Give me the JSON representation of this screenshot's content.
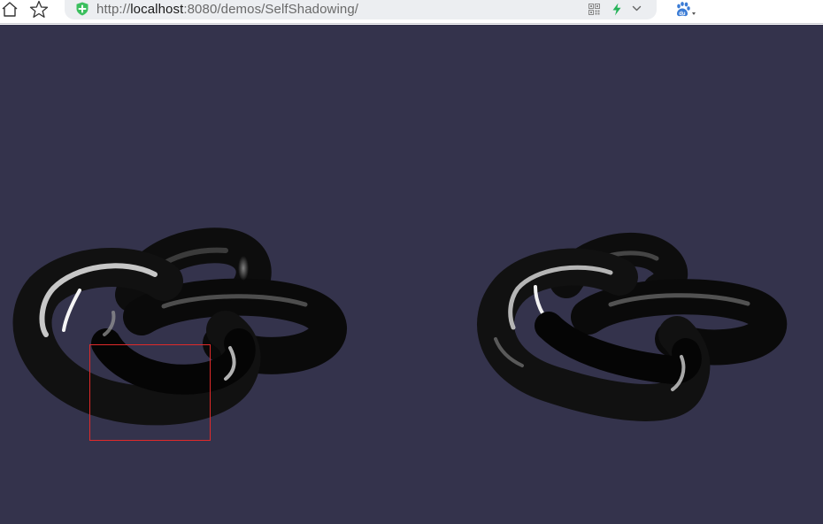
{
  "browser": {
    "url_scheme": "http://",
    "url_host": "localhost",
    "url_rest": ":8080/demos/SelfShadowing/",
    "icons": {
      "home": "home-icon",
      "bookmark": "star-icon",
      "security": "shield-plus-icon",
      "qr": "qr-code-icon",
      "accelerate": "lightning-bolt-icon",
      "menu": "chevron-down-icon",
      "search_engine": "baidu-paw-icon"
    },
    "colors": {
      "address_bar": "#eceef1",
      "security_icon": "#3bbf5e",
      "bolt_icon": "#27b35a",
      "search_engine_icon": "#3a7bd5"
    }
  },
  "viewport": {
    "background": "#34334c",
    "content": [
      "knot-mesh-left",
      "knot-mesh-right"
    ],
    "selection_color": "#e02a2a"
  }
}
